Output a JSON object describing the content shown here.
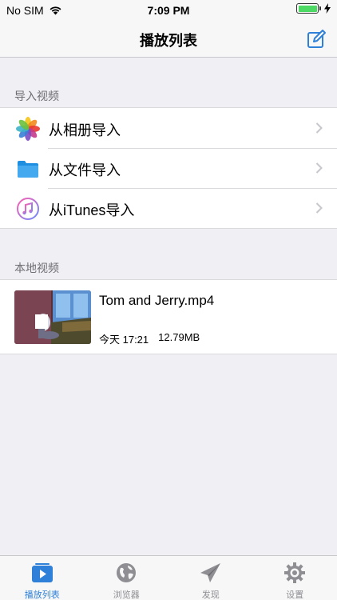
{
  "status_bar": {
    "carrier": "No SIM",
    "time": "7:09 PM",
    "battery_level": 1.0
  },
  "nav": {
    "title": "播放列表",
    "edit_icon": "compose-icon"
  },
  "import_section": {
    "header": "导入视频",
    "items": [
      {
        "label": "从相册导入",
        "icon": "photos-icon"
      },
      {
        "label": "从文件导入",
        "icon": "folder-icon"
      },
      {
        "label": "从iTunes导入",
        "icon": "itunes-icon"
      }
    ]
  },
  "local_section": {
    "header": "本地视频",
    "videos": [
      {
        "title": "Tom and Jerry.mp4",
        "date": "今天 17:21",
        "size": "12.79MB"
      }
    ]
  },
  "tab_bar": {
    "tabs": [
      {
        "label": "播放列表",
        "icon": "play-list-icon",
        "active": true
      },
      {
        "label": "浏览器",
        "icon": "globe-icon",
        "active": false
      },
      {
        "label": "发现",
        "icon": "paper-plane-icon",
        "active": false
      },
      {
        "label": "设置",
        "icon": "gear-icon",
        "active": false
      }
    ]
  },
  "colors": {
    "accent": "#2f80d8",
    "background": "#efeff4",
    "inactive_tab": "#8e8e93"
  }
}
